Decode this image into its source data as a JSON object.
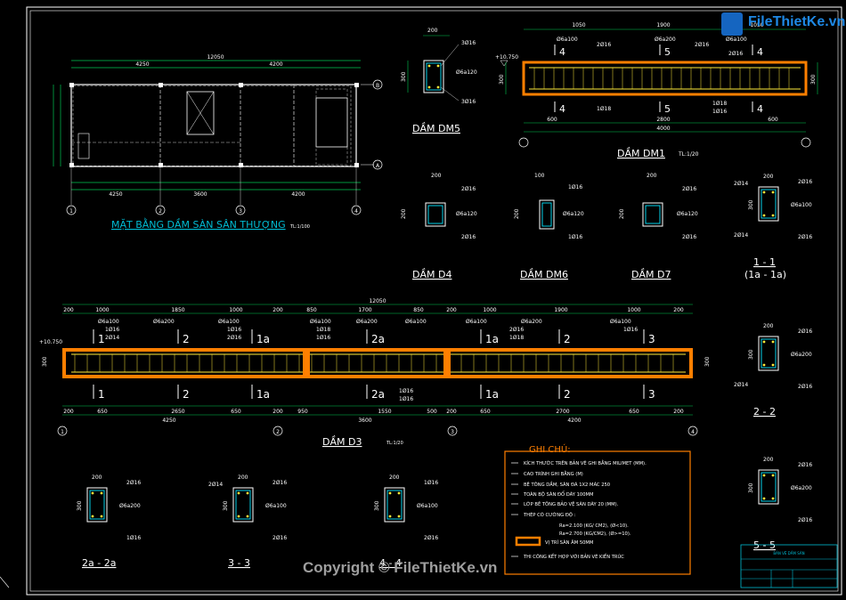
{
  "logo": {
    "text": "FileThietKe.vn"
  },
  "watermark": "Copyright © FileThietKe.vn",
  "plan": {
    "title": "MẶT BẰNG DẦM SÀN SÂN THƯỢNG",
    "scale": "TL:1/100",
    "dim_total": "12050",
    "dim_top": [
      "4250",
      "4200"
    ],
    "dim_bottom": [
      "4250",
      "3600",
      "4200"
    ],
    "axes": [
      "1",
      "2",
      "3",
      "4",
      "B",
      "A"
    ]
  },
  "beams": {
    "dm5": {
      "title": "DẦM DM5",
      "w": "200",
      "h": "300",
      "top": "3Ø16",
      "stirrup": "Ø6a120",
      "bot": "3Ø16"
    },
    "dm1": {
      "title": "DẦM DM1",
      "scale": "TL:1/20",
      "level": "+10.750",
      "h": "300",
      "dims_top": [
        "1050",
        "1900",
        "1050"
      ],
      "dims_bot": [
        "600",
        "2800",
        "600"
      ],
      "total": "4000",
      "stir_a": "Ø6a100",
      "stir_b": "Ø6a200",
      "bars": [
        "2Ø16",
        "2Ø16",
        "2Ø16",
        "1Ø18",
        "1Ø18",
        "1Ø16"
      ],
      "sections": [
        "4",
        "5",
        "4"
      ]
    },
    "d4": {
      "title": "DẦM D4",
      "w": "200",
      "h": "200",
      "top": "2Ø16",
      "stirrup": "Ø6a120",
      "bot": "2Ø16"
    },
    "dm6": {
      "title": "DẦM DM6",
      "w": "100",
      "h": "200",
      "top": "1Ø16",
      "stirrup": "Ø6a120",
      "bot": "1Ø16"
    },
    "d7": {
      "title": "DẦM D7",
      "w": "200",
      "h": "200",
      "top": "2Ø16",
      "stirrup": "Ø6a120",
      "bot": "2Ø16"
    }
  },
  "sections": [
    {
      "title": "1 - 1",
      "sub": "(1a - 1a)",
      "w": "200",
      "h": "300",
      "top_l": "2Ø14",
      "top_r": "2Ø16",
      "stirrup": "Ø6a100",
      "bot_l": "2Ø14",
      "bot_r": "2Ø16"
    },
    {
      "title": "2 - 2",
      "sub": "",
      "w": "200",
      "h": "300",
      "top_l": "",
      "top_r": "2Ø16",
      "stirrup": "Ø6a200",
      "bot_l": "2Ø14",
      "bot_r": "2Ø16"
    },
    {
      "title": "5 - 5",
      "sub": "",
      "w": "200",
      "h": "300",
      "top_l": "",
      "top_r": "2Ø16",
      "stirrup": "Ø6a200",
      "bot_l": "",
      "bot_r": "2Ø16"
    },
    {
      "title": "2a - 2a",
      "sub": "",
      "w": "200",
      "h": "300",
      "top_l": "",
      "top_r": "2Ø16",
      "stirrup": "Ø6a200",
      "bot_l": "",
      "bot_r": "1Ø16"
    },
    {
      "title": "3 - 3",
      "sub": "",
      "w": "200",
      "h": "300",
      "top_l": "2Ø14",
      "top_r": "2Ø16",
      "stirrup": "Ø6a100",
      "bot_l": "",
      "bot_r": "2Ø16"
    },
    {
      "title": "4 - 4",
      "sub": "",
      "w": "200",
      "h": "300",
      "top_l": "",
      "top_r": "1Ø16",
      "stirrup": "Ø6a100",
      "bot_l": "",
      "bot_r": "2Ø16"
    }
  ],
  "d3": {
    "title": "DẦM D3",
    "scale": "TL:1/20",
    "level": "+10.750",
    "h": "300",
    "total": "12050",
    "dims_top": [
      "200",
      "1000",
      "1850",
      "1000",
      "200",
      "850",
      "1700",
      "850",
      "200",
      "1000",
      "1900",
      "1000",
      "200"
    ],
    "dims_bot": [
      "200",
      "650",
      "2650",
      "650",
      "200",
      "950",
      "1550",
      "500",
      "200",
      "650",
      "2700",
      "650",
      "200"
    ],
    "spans": [
      "4250",
      "3600",
      "4200"
    ],
    "stirrups": [
      "Ø6a100",
      "Ø6a200",
      "Ø6a100",
      "Ø6a100",
      "Ø6a200",
      "Ø6a100",
      "Ø6a100",
      "Ø6a200",
      "Ø6a100"
    ],
    "cuts": [
      "1",
      "2",
      "1a",
      "2a",
      "1a",
      "2",
      "3"
    ],
    "axes": [
      "1",
      "2",
      "3",
      "4"
    ],
    "bars": [
      "1Ø16",
      "2Ø14",
      "1Ø16",
      "2Ø16",
      "1Ø18",
      "1Ø16",
      "1Ø16",
      "1Ø16",
      "2Ø16",
      "1Ø18",
      "1Ø16"
    ]
  },
  "notes": {
    "title": "GHI CHÚ:",
    "lines": [
      "KÍCH THƯỚC TRÊN BẢN VẼ GHI BẰNG MILIMET (MM).",
      "CAO TRÌNH GHI BẰNG (M)",
      "BÊ TÔNG DẦM, SÀN ĐÁ 1X2 MÁC 250",
      "TOÀN BỘ SÀN ĐỔ DÀY 100MM",
      "LỚP BÊ TÔNG BẢO VỆ SÀN DÀY 20 (MM).",
      "THÉP CÓ CƯỜNG ĐỘ :",
      "Ra=2.100 (KG/ CM2), (Ø<10).",
      "Ra=2.700 (KG/CM2), (Ø>=10).",
      "VỊ TRÍ SÀN ÂM 50MM",
      "THI CÔNG KẾT HỢP VỚI BẢN VẼ KIẾN TRÚC"
    ]
  },
  "titleblock": {
    "name": "BẢN VẼ DẦM SÀN",
    "rows": [
      "",
      ""
    ]
  },
  "colors": {
    "bg": "#000000",
    "dim": "#00c853",
    "text": "#ffffff",
    "beam": "#ff7f00",
    "rebar": "#ffeb3b",
    "stirrup": "#00e5ff",
    "title": "#00bcd4",
    "axis": "#ffffff"
  }
}
